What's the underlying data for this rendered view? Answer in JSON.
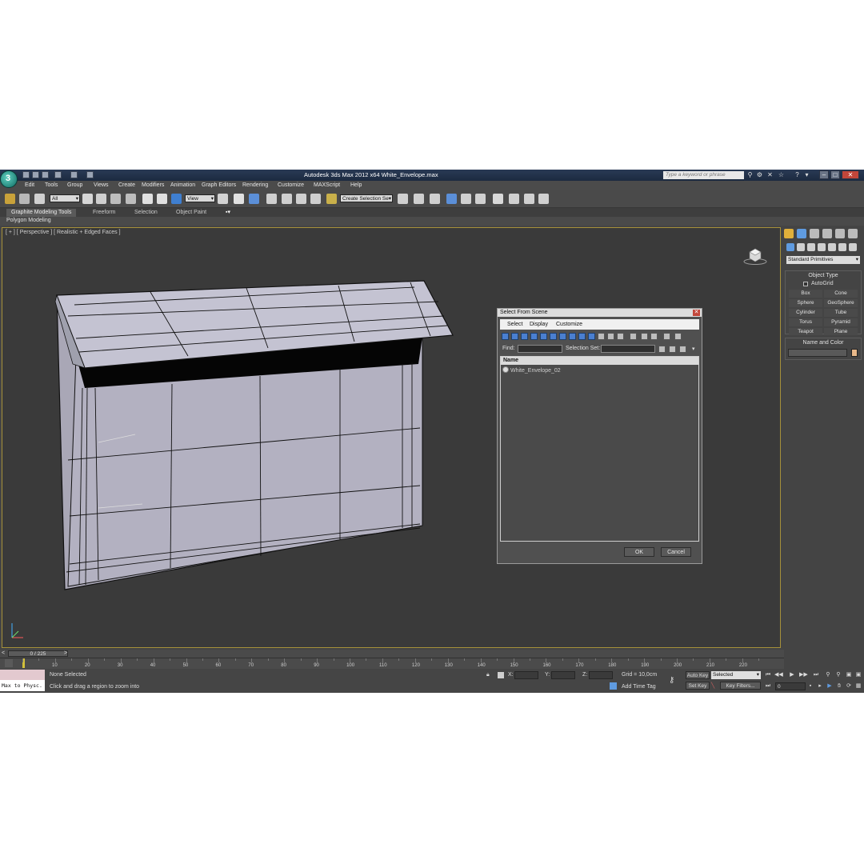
{
  "window": {
    "title": "Autodesk 3ds Max  2012 x64     White_Envelope.max",
    "help_search_placeholder": "Type a keyword or phrase"
  },
  "menu": [
    "Edit",
    "Tools",
    "Group",
    "Views",
    "Create",
    "Modifiers",
    "Animation",
    "Graph Editors",
    "Rendering",
    "Customize",
    "MAXScript",
    "Help"
  ],
  "toolbar": {
    "selection_filter": "All",
    "reference_coord": "View",
    "named_selection_set": "Create Selection Se"
  },
  "ribbon": {
    "tabs": [
      "Graphite Modeling Tools",
      "Freeform",
      "Selection",
      "Object Paint"
    ],
    "sub_label": "Polygon Modeling"
  },
  "viewport": {
    "label": "[ + ] [ Perspective ] [ Realistic + Edged Faces ]"
  },
  "dialog": {
    "title": "Select From Scene",
    "menu": [
      "Select",
      "Display",
      "Customize"
    ],
    "find_label": "Find:",
    "selection_set_label": "Selection Set:",
    "column_name": "Name",
    "objects": [
      "White_Envelope_02"
    ],
    "ok_label": "OK",
    "cancel_label": "Cancel"
  },
  "command_panel": {
    "category": "Standard Primitives",
    "object_type_title": "Object Type",
    "autogrid_label": "AutoGrid",
    "primitives": [
      "Box",
      "Cone",
      "Sphere",
      "GeoSphere",
      "Cylinder",
      "Tube",
      "Torus",
      "Pyramid",
      "Teapot",
      "Plane"
    ],
    "name_color_title": "Name and Color",
    "object_color": "#e8b88a"
  },
  "timeline": {
    "frame_display": "0 / 225",
    "ticks": [
      "10",
      "20",
      "30",
      "40",
      "50",
      "60",
      "70",
      "80",
      "90",
      "100",
      "110",
      "120",
      "130",
      "140",
      "150",
      "160",
      "170",
      "180",
      "190",
      "200",
      "210",
      "220"
    ]
  },
  "status": {
    "maxscript_listener": "Max to Physc.",
    "selection_status": "None Selected",
    "prompt": "Click and drag a region to zoom into",
    "x_label": "X:",
    "y_label": "Y:",
    "z_label": "Z:",
    "grid": "Grid = 10,0cm",
    "add_time_tag": "Add Time Tag",
    "auto_key": "Auto Key",
    "auto_key_mode": "Selected",
    "set_key": "Set Key",
    "key_filters": "Key Filters...",
    "current_frame": "0"
  }
}
